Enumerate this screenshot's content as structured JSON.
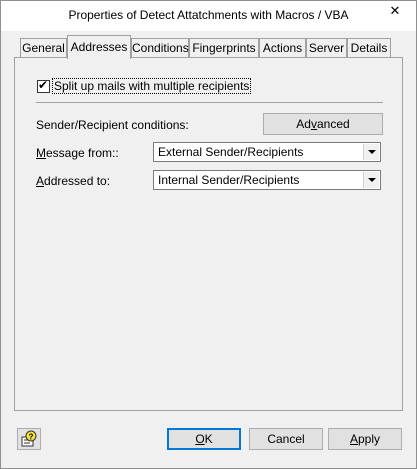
{
  "window": {
    "title": "Properties of Detect Attatchments with Macros / VBA",
    "close_glyph": "✕"
  },
  "tabs": [
    {
      "label": "General",
      "active": false
    },
    {
      "label": "Addresses",
      "active": true
    },
    {
      "label": "Conditions",
      "active": false
    },
    {
      "label": "Fingerprints",
      "active": false
    },
    {
      "label": "Actions",
      "active": false
    },
    {
      "label": "Server",
      "active": false
    },
    {
      "label": "Details",
      "active": false
    }
  ],
  "addresses": {
    "split_checkbox": {
      "label": "Split up mails with multiple recipients",
      "checked": true
    },
    "conditions_label": "Sender/Recipient conditions:",
    "advanced_button": {
      "label_pre": "Ad",
      "label_u": "v",
      "label_post": "anced"
    },
    "message_from": {
      "label_u": "M",
      "label_rest": "essage from::",
      "value": "External Sender/Recipients"
    },
    "addressed_to": {
      "label_u": "A",
      "label_rest": "ddressed to:",
      "value": "Internal Sender/Recipients"
    }
  },
  "footer": {
    "help_icon": "help-icon",
    "ok": {
      "label_u": "O",
      "label_rest": "K"
    },
    "cancel": {
      "label": "Cancel"
    },
    "apply": {
      "label_u": "A",
      "label_rest": "pply"
    }
  }
}
